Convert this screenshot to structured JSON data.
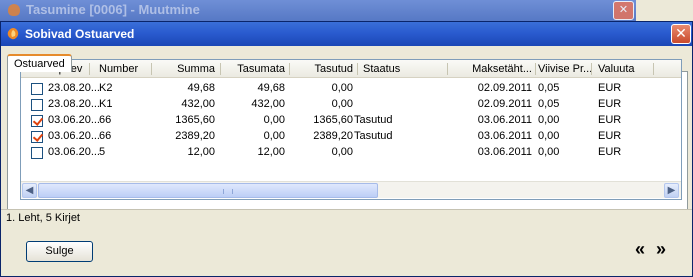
{
  "background_window": {
    "title": "Tasumine [0006] - Muutmine"
  },
  "dialog": {
    "title": "Sobivad Ostuarved",
    "close_glyph": "✕",
    "tab_label": "Ostuarved",
    "columns": [
      "Kuupäev",
      "Number",
      "Summa",
      "Tasumata",
      "Tasutud",
      "Staatus",
      "Maksetäht...",
      "Viivise Pr...",
      "Valuuta"
    ],
    "rows": [
      {
        "checked": false,
        "date": "23.08.20...",
        "number": "K2",
        "summa": "49,68",
        "tasumata": "49,68",
        "tasutud": "0,00",
        "staatus": "",
        "maksetaht": "02.09.2011",
        "viivis": "0,05",
        "valuuta": "EUR"
      },
      {
        "checked": false,
        "date": "23.08.20...",
        "number": "K1",
        "summa": "432,00",
        "tasumata": "432,00",
        "tasutud": "0,00",
        "staatus": "",
        "maksetaht": "02.09.2011",
        "viivis": "0,05",
        "valuuta": "EUR"
      },
      {
        "checked": true,
        "date": "03.06.20...",
        "number": "66",
        "summa": "1365,60",
        "tasumata": "0,00",
        "tasutud": "1365,60",
        "staatus": "Tasutud",
        "maksetaht": "03.06.2011",
        "viivis": "0,00",
        "valuuta": "EUR"
      },
      {
        "checked": true,
        "date": "03.06.20...",
        "number": "66",
        "summa": "2389,20",
        "tasumata": "0,00",
        "tasutud": "2389,20",
        "staatus": "Tasutud",
        "maksetaht": "03.06.2011",
        "viivis": "0,00",
        "valuuta": "EUR"
      },
      {
        "checked": false,
        "date": "03.06.20...",
        "number": "5",
        "summa": "12,00",
        "tasumata": "12,00",
        "tasutud": "0,00",
        "staatus": "",
        "maksetaht": "03.06.2011",
        "viivis": "0,00",
        "valuuta": "EUR"
      }
    ],
    "status_text": "1. Leht, 5 Kirjet",
    "close_button_label": "Sulge",
    "nav_prev": "«",
    "nav_next": "»",
    "colors": {
      "titlebar": "#2a5bcf",
      "tab_accent": "#e68b2c",
      "check": "#e0420d"
    }
  }
}
